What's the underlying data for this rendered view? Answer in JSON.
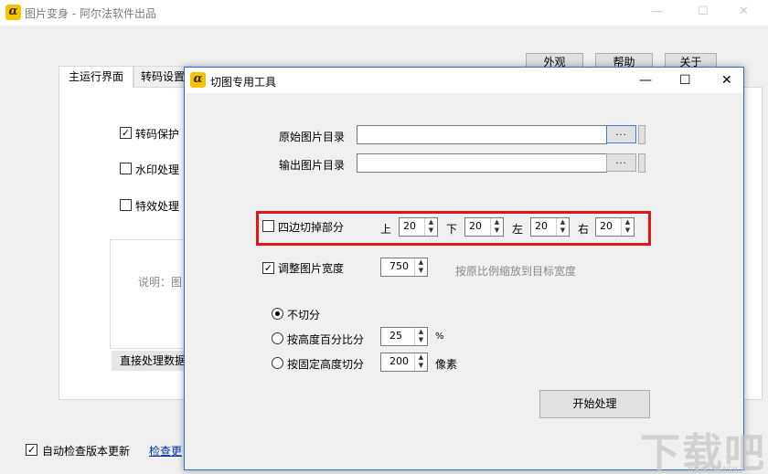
{
  "main_window": {
    "title": "图片变身 - 阿尔法软件出品",
    "logo_letter": "α",
    "controls": {
      "minimize": "—",
      "maximize": "☐",
      "close": "✕"
    },
    "top_buttons": [
      {
        "label": "外观"
      },
      {
        "label": "帮助"
      },
      {
        "label": "关于"
      }
    ],
    "tabs": [
      {
        "label": "主运行界面"
      },
      {
        "label": "转码设置"
      }
    ],
    "options": [
      {
        "label": "转码保护",
        "checked": true
      },
      {
        "label": "水印处理",
        "checked": false
      },
      {
        "label": "特效处理",
        "checked": false
      }
    ],
    "description_label": "说明：图",
    "direct_process_label": "直接处理数据",
    "auto_update": {
      "label": "自动检查版本更新",
      "checked": true
    },
    "check_update_link": "检查更"
  },
  "dialog": {
    "title": "切图专用工具",
    "logo_letter": "α",
    "controls": {
      "minimize": "—",
      "maximize": "☐",
      "close": "✕"
    },
    "source_dir": {
      "label": "原始图片目录",
      "value": "",
      "browse": "..."
    },
    "output_dir": {
      "label": "输出图片目录",
      "value": "",
      "browse": "..."
    },
    "crop_edges": {
      "label": "四边切掉部分",
      "checked": false,
      "top": {
        "label": "上",
        "value": "20"
      },
      "bottom": {
        "label": "下",
        "value": "20"
      },
      "left": {
        "label": "左",
        "value": "20"
      },
      "right": {
        "label": "右",
        "value": "20"
      }
    },
    "resize": {
      "label": "调整图片宽度",
      "checked": true,
      "value": "750",
      "hint": "按原比例缩放到目标宽度"
    },
    "split_mode": {
      "selected": "no_split",
      "no_split": {
        "label": "不切分"
      },
      "by_percent": {
        "label": "按高度百分比分",
        "value": "25",
        "unit": "%"
      },
      "by_fixed": {
        "label": "按固定高度切分",
        "value": "200",
        "unit": "像素"
      }
    },
    "start_button": "开始处理"
  },
  "watermark": {
    "text": "下载吧",
    "url": "www.xiazaiba.com"
  },
  "colors": {
    "highlight": "#e0161c",
    "dialog_border": "#2b6fd1",
    "logo": "#f5c400"
  }
}
